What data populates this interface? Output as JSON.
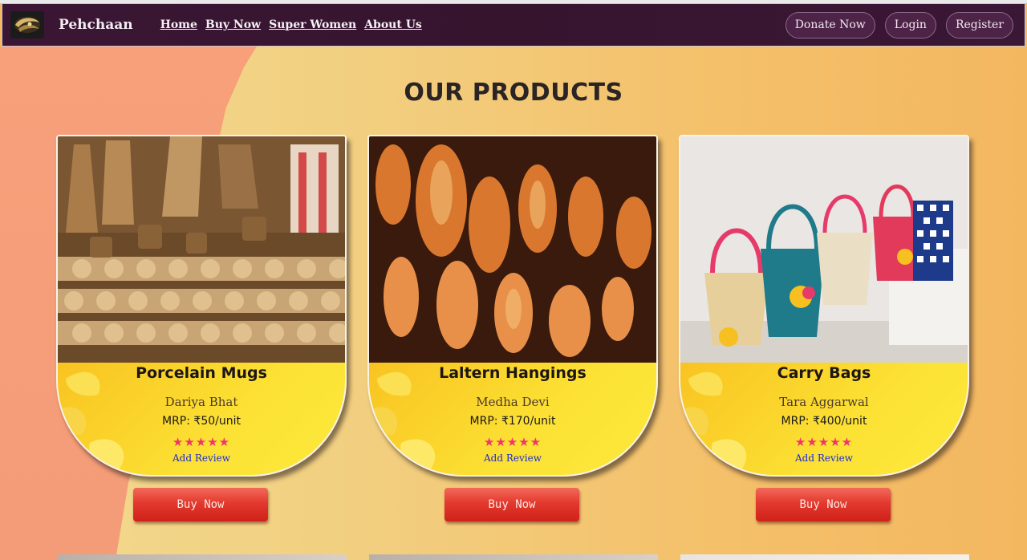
{
  "navbar": {
    "brand": "Pehchaan",
    "links": [
      "Home",
      "Buy Now",
      "Super Women",
      "About Us"
    ],
    "actions": [
      "Donate Now",
      "Login",
      "Register"
    ]
  },
  "section_title": "OUR PRODUCTS",
  "products": [
    {
      "title": "Porcelain Mugs",
      "maker": "Dariya Bhat",
      "price": "MRP: ₹50/unit",
      "stars": "★★★★★",
      "rating": 5,
      "review_label": "Add Review",
      "buy_label": "Buy Now"
    },
    {
      "title": "Laltern Hangings",
      "maker": "Medha Devi",
      "price": "MRP: ₹170/unit",
      "stars": "★★★★★",
      "rating": 5,
      "review_label": "Add Review",
      "buy_label": "Buy Now"
    },
    {
      "title": "Carry Bags",
      "maker": "Tara Aggarwal",
      "price": "MRP: ₹400/unit",
      "stars": "★★★★★",
      "rating": 5,
      "review_label": "Add Review",
      "buy_label": "Buy Now"
    }
  ],
  "colors": {
    "navbar": "#3a1634",
    "card_yellow": "#fce234",
    "star": "#f0356a",
    "buy_button": "#e3392e",
    "review_link": "#1b2bd8"
  }
}
